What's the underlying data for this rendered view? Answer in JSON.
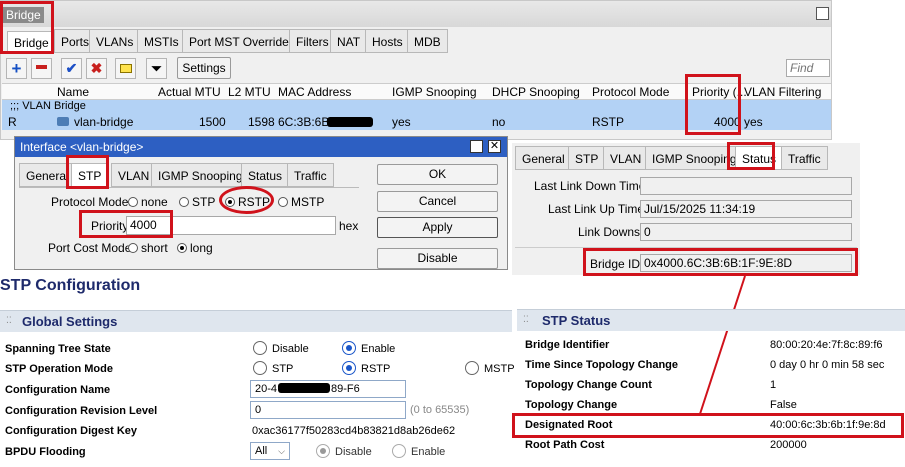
{
  "window": {
    "title": "Bridge"
  },
  "main_tabs": [
    "Bridge",
    "Ports",
    "VLANs",
    "MSTIs",
    "Port MST Overrides",
    "Filters",
    "NAT",
    "Hosts",
    "MDB"
  ],
  "toolbar": {
    "settings_label": "Settings",
    "find_placeholder": "Find"
  },
  "table": {
    "columns": [
      "Name",
      "Actual MTU",
      "L2 MTU",
      "MAC Address",
      "IGMP Snooping",
      "DHCP Snooping",
      "Protocol Mode",
      "Priority (...",
      "VLAN Filtering"
    ],
    "group_label": ";;; VLAN Bridge",
    "row": {
      "flag": "R",
      "name": "vlan-bridge",
      "actual_mtu": "1500",
      "l2_mtu": "1598",
      "mac": "6C:3B:6B",
      "igmp": "yes",
      "dhcp": "no",
      "protocol": "RSTP",
      "priority": "4000",
      "vlan_filtering": "yes"
    }
  },
  "dialog": {
    "title": "Interface <vlan-bridge>",
    "tabs": [
      "General",
      "STP",
      "VLAN",
      "IGMP Snooping",
      "Status",
      "Traffic"
    ],
    "protocol_mode_label": "Protocol Mode:",
    "protocol_options": [
      "none",
      "STP",
      "RSTP",
      "MSTP"
    ],
    "priority_label": "Priority:",
    "priority_value": "4000",
    "priority_unit": "hex",
    "port_cost_label": "Port Cost Mode:",
    "port_cost_options": [
      "short",
      "long"
    ],
    "buttons": [
      "OK",
      "Cancel",
      "Apply",
      "Disable"
    ]
  },
  "status_panel": {
    "tabs": [
      "General",
      "STP",
      "VLAN",
      "IGMP Snooping",
      "Status",
      "Traffic"
    ],
    "last_link_down_label": "Last Link Down Time:",
    "last_link_down_value": "",
    "last_link_up_label": "Last Link Up Time:",
    "last_link_up_value": "Jul/15/2025 11:34:19",
    "link_downs_label": "Link Downs:",
    "link_downs_value": "0",
    "bridge_id_label": "Bridge ID:",
    "bridge_id_value": "0x4000.6C:3B:6B:1F:9E:8D"
  },
  "web": {
    "heading": "STP Configuration",
    "global": {
      "title": "Global Settings",
      "rows": [
        {
          "label": "Spanning Tree State",
          "options": [
            "Disable",
            "Enable"
          ]
        },
        {
          "label": "STP Operation Mode",
          "options": [
            "STP",
            "RSTP",
            "MSTP"
          ]
        },
        {
          "label": "Configuration Name",
          "value_prefix": "20-4",
          "value_suffix": "89-F6"
        },
        {
          "label": "Configuration Revision Level",
          "value": "0",
          "hint": "(0 to 65535)"
        },
        {
          "label": "Configuration Digest Key",
          "value": "0xac36177f50283cd4b83821d8ab26de62"
        },
        {
          "label": "BPDU Flooding",
          "select": "All",
          "options": [
            "Disable",
            "Enable"
          ]
        }
      ]
    },
    "status": {
      "title": "STP Status",
      "rows": [
        {
          "label": "Bridge Identifier",
          "value": "80:00:20:4e:7f:8c:89:f6"
        },
        {
          "label": "Time Since Topology Change",
          "value": "0 day 0 hr 0 min 58 sec"
        },
        {
          "label": "Topology Change Count",
          "value": "1"
        },
        {
          "label": "Topology Change",
          "value": "False"
        },
        {
          "label": "Designated Root",
          "value": "40:00:6c:3b:6b:1f:9e:8d"
        },
        {
          "label": "Root Path Cost",
          "value": "200000"
        }
      ]
    }
  },
  "colors": {
    "highlight_red": "#d0121b",
    "row_selected": "#b3d2f5",
    "web_header_bg": "#dfe6ee",
    "web_title": "#1e2a6b"
  }
}
